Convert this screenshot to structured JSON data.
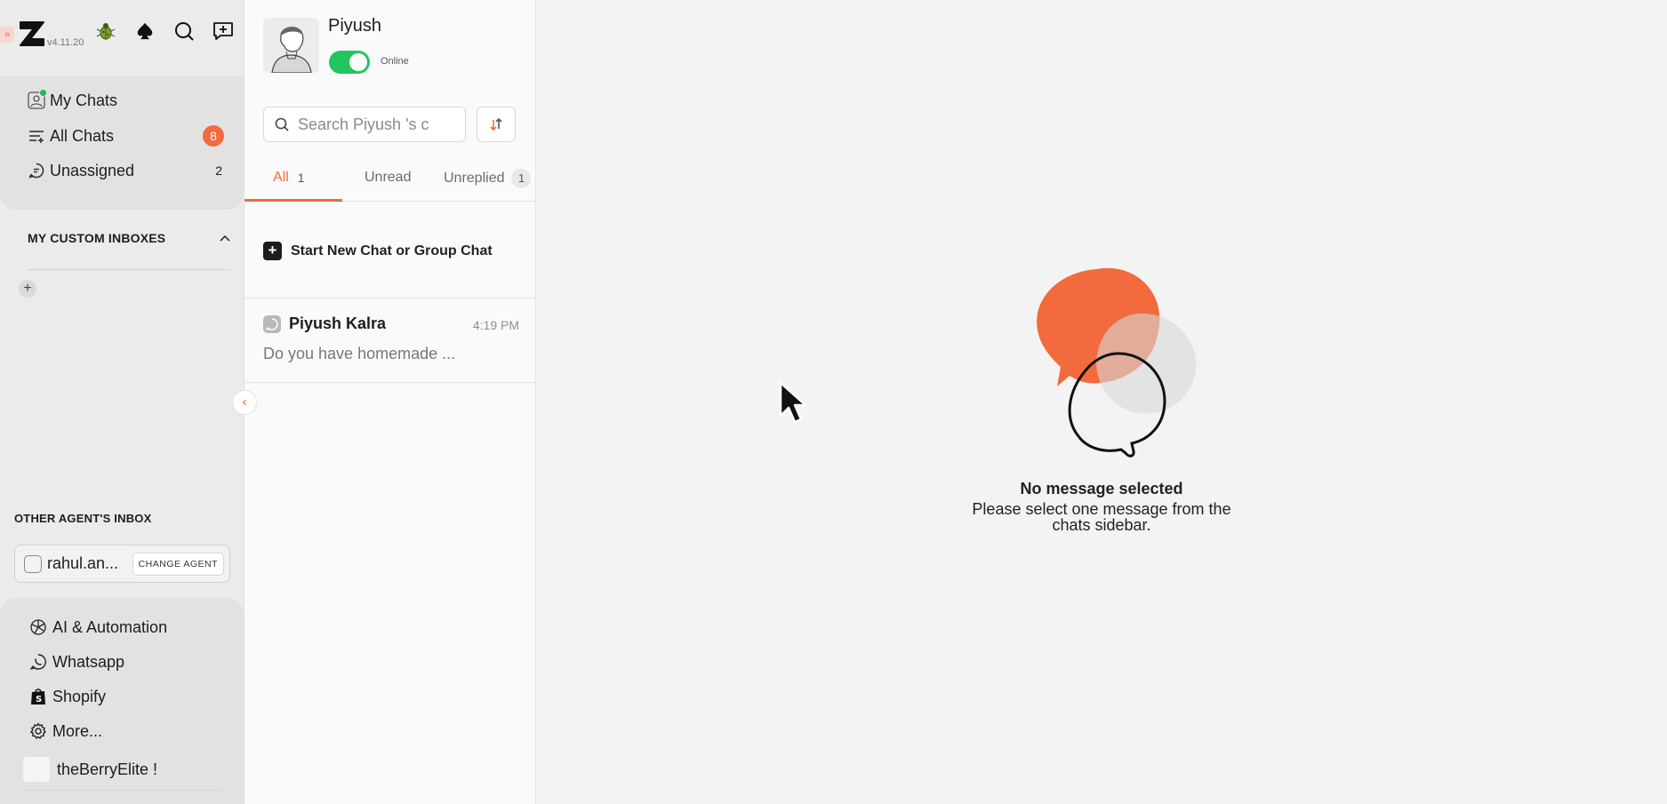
{
  "app": {
    "version": "v4.11.20",
    "accent": "#f26a3d",
    "online_green": "#22c55e"
  },
  "top_icons": [
    "bug-icon",
    "spade-icon",
    "search-icon",
    "new-chat-icon"
  ],
  "nav": {
    "my_chats": {
      "label": "My Chats"
    },
    "all_chats": {
      "label": "All Chats",
      "badge": "8"
    },
    "unassigned": {
      "label": "Unassigned",
      "count": "2"
    }
  },
  "custom_inboxes": {
    "title": "MY CUSTOM INBOXES"
  },
  "other_agents": {
    "title": "OTHER AGENT'S INBOX",
    "agent_name": "rahul.an...",
    "change_label": "CHANGE AGENT"
  },
  "bottom_nav": {
    "ai": "AI & Automation",
    "whatsapp": "Whatsapp",
    "shopify": "Shopify",
    "more": "More...",
    "store": "theBerryElite !"
  },
  "profile": {
    "name": "Piyush",
    "status": "Online",
    "status_on": true
  },
  "search": {
    "placeholder": "Search Piyush 's c"
  },
  "tabs": [
    {
      "label": "All",
      "count": "1",
      "active": true
    },
    {
      "label": "Unread",
      "count": "",
      "active": false
    },
    {
      "label": "Unreplied",
      "count": "1",
      "active": false
    }
  ],
  "new_chat_label": "Start New Chat or Group Chat",
  "chats": [
    {
      "name": "Piyush Kalra",
      "time": "4:19 PM",
      "preview": "Do you have homemade ..."
    }
  ],
  "empty_state": {
    "title": "No message selected",
    "line1": "Please select one message from the",
    "line2": "chats sidebar."
  }
}
